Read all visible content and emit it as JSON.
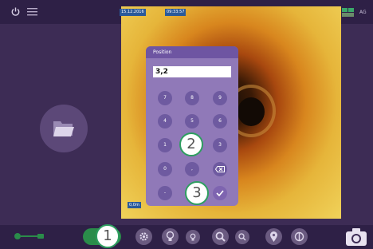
{
  "status_bar": {
    "date": "15.12.2016",
    "time": "09:33:57",
    "right_text": "AG"
  },
  "overlay": {
    "depth_readout": "0,0m"
  },
  "keypad": {
    "title": "Position",
    "input_value": "3,2",
    "keys": [
      "7",
      "8",
      "9",
      "4",
      "5",
      "6",
      "1",
      "2",
      "3",
      "0",
      ",",
      "backspace",
      "-",
      "",
      "confirm"
    ]
  },
  "callouts": {
    "one": "1",
    "two": "2",
    "three": "3"
  },
  "icons": {
    "power": "power-icon",
    "menu": "menu-icon",
    "folder": "folder-icon",
    "connection": "connection-icon",
    "settings": "gear-icon",
    "light_high": "bulb-icon",
    "light_low": "bulb-small-icon",
    "zoom_in": "zoom-in-icon",
    "zoom_out": "zoom-out-icon",
    "location": "location-pin-icon",
    "split": "split-icon",
    "camera": "camera-icon"
  },
  "colors": {
    "background": "#3d2c55",
    "bars": "#2e2046",
    "keypad": "#9079b8",
    "keypad_header": "#6e55a2",
    "key": "#6e5aa0",
    "callout_border": "#2e9e60",
    "timestamp_bg": "#2a5a9a",
    "toggle": "#2a8c4a"
  }
}
